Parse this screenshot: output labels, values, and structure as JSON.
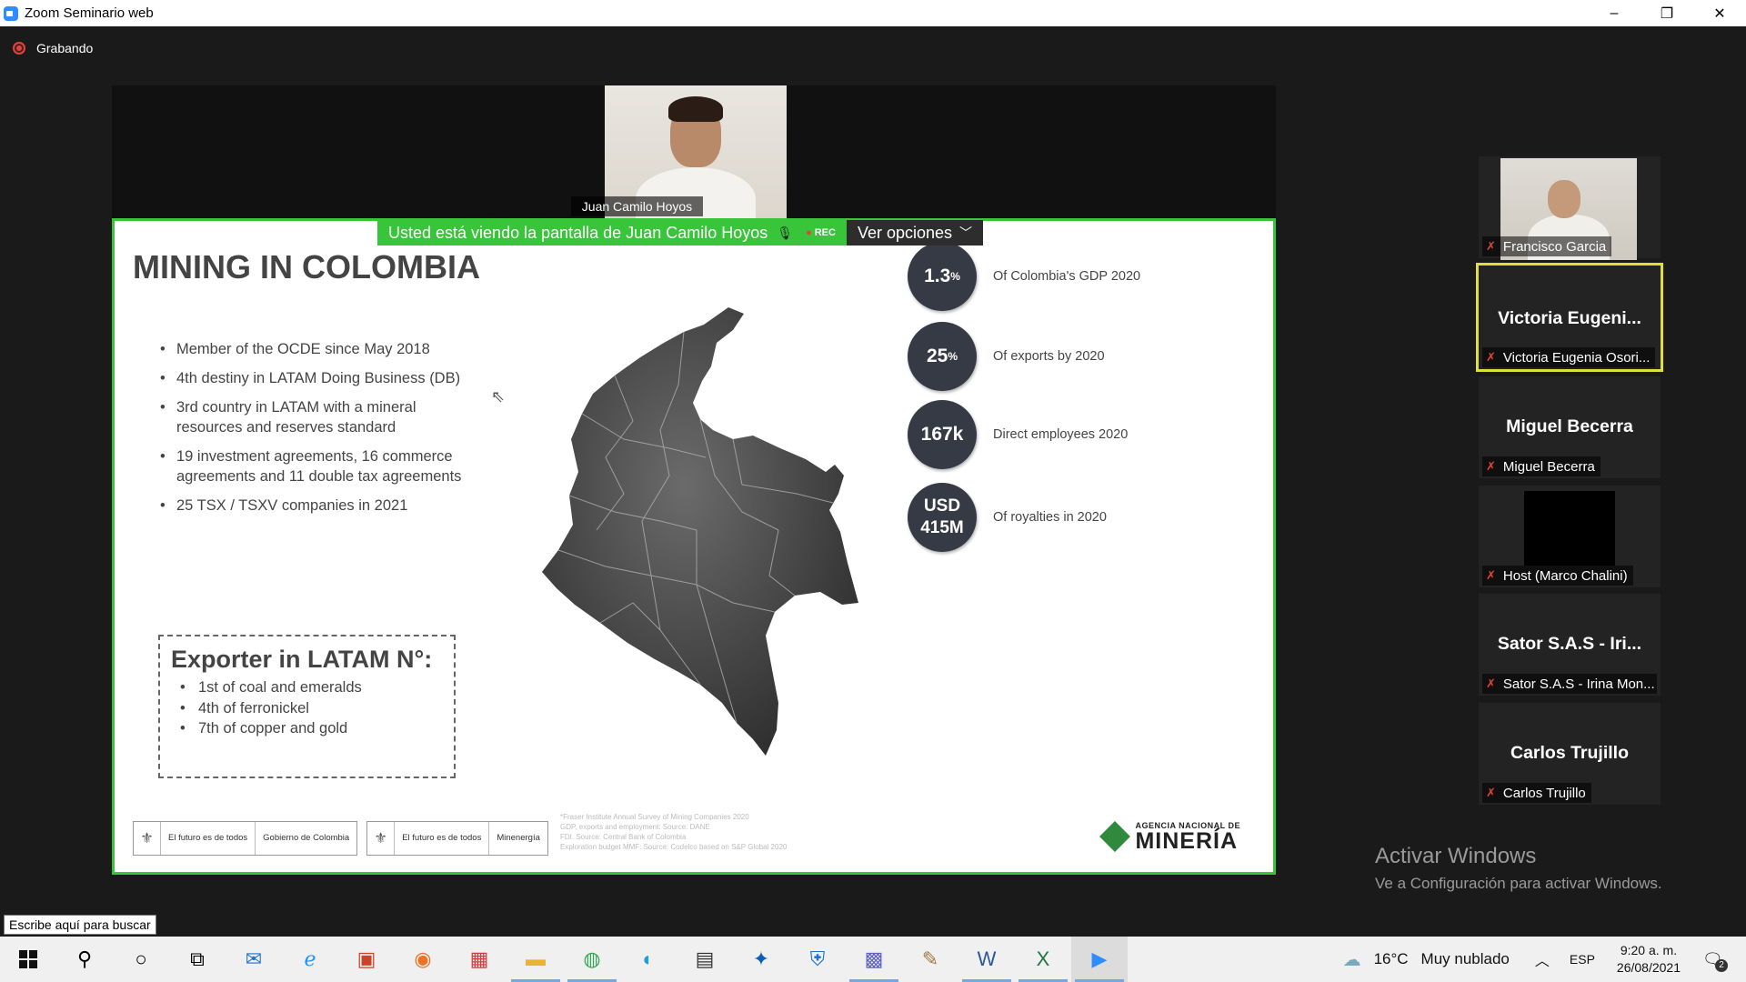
{
  "window": {
    "title": "Zoom Seminario web",
    "controls": {
      "minimize": "–",
      "restore": "❐",
      "close": "✕"
    }
  },
  "recording": {
    "label": "Grabando"
  },
  "share": {
    "speaker_name": "Juan Camilo Hoyos",
    "banner_text": "Usted está viendo la pantalla de Juan Camilo Hoyos",
    "rec_label": "REC",
    "options_label": "Ver opciones"
  },
  "slide": {
    "title": "MINING IN COLOMBIA",
    "bullets": [
      "Member of the OCDE since May 2018",
      "4th destiny in LATAM Doing Business (DB)",
      "3rd country in LATAM with a mineral resources and reserves standard",
      "19 investment agreements, 16 commerce agreements and 11 double tax agreements",
      "25 TSX / TSXV companies in 2021"
    ],
    "exporter": {
      "title": "Exporter in LATAM N°:",
      "items": [
        "1st of coal and emeralds",
        "4th of ferronickel",
        "7th of copper and gold"
      ]
    },
    "stats": [
      {
        "value": "1.3",
        "unit": "%",
        "label": "Of Colombia's GDP  2020"
      },
      {
        "value": "25",
        "unit": "%",
        "label": "Of exports by 2020"
      },
      {
        "value": "167k",
        "unit": "",
        "label": "Direct employees 2020"
      },
      {
        "value": "USD 415M",
        "unit": "",
        "label": "Of royalties in 2020"
      }
    ],
    "footnotes": [
      "*Fraser Institute Annual Survey of Mining Companies 2020",
      "GDP, exports and employment:  Source: DANE",
      "FDI. Source: Central Bank of Colombia",
      "Exploration budget MMF: Source: Codelco based on S&P Global 2020"
    ],
    "gov_logos": [
      {
        "left": "El futuro es de todos",
        "right": "Gobierno de Colombia"
      },
      {
        "left": "El futuro es de todos",
        "right": "Minenergía"
      }
    ],
    "agency_small": "AGENCIA NACIONAL DE",
    "agency_big": "MINERÍA"
  },
  "participants": [
    {
      "display": "",
      "name": "Francisco Garcia",
      "video": "camera"
    },
    {
      "display": "Victoria  Eugeni...",
      "name": "Victoria Eugenia Osori...",
      "active": true
    },
    {
      "display": "Miguel Becerra",
      "name": "Miguel Becerra"
    },
    {
      "display": "",
      "name": "Host (Marco Chalini)",
      "video": "black"
    },
    {
      "display": "Sator S.A.S - Iri...",
      "name": "Sator S.A.S - Irina Mon..."
    },
    {
      "display": "Carlos Trujillo",
      "name": "Carlos Trujillo"
    }
  ],
  "watermark": {
    "line1": "Activar Windows",
    "line2": "Ve a Configuración para activar Windows."
  },
  "search_tooltip": "Escribe aquí para buscar",
  "taskbar": {
    "weather_temp": "16°C",
    "weather_text": "Muy nublado",
    "lang": "ESP",
    "time": "9:20 a. m.",
    "date": "26/08/2021",
    "notifications": "2"
  }
}
